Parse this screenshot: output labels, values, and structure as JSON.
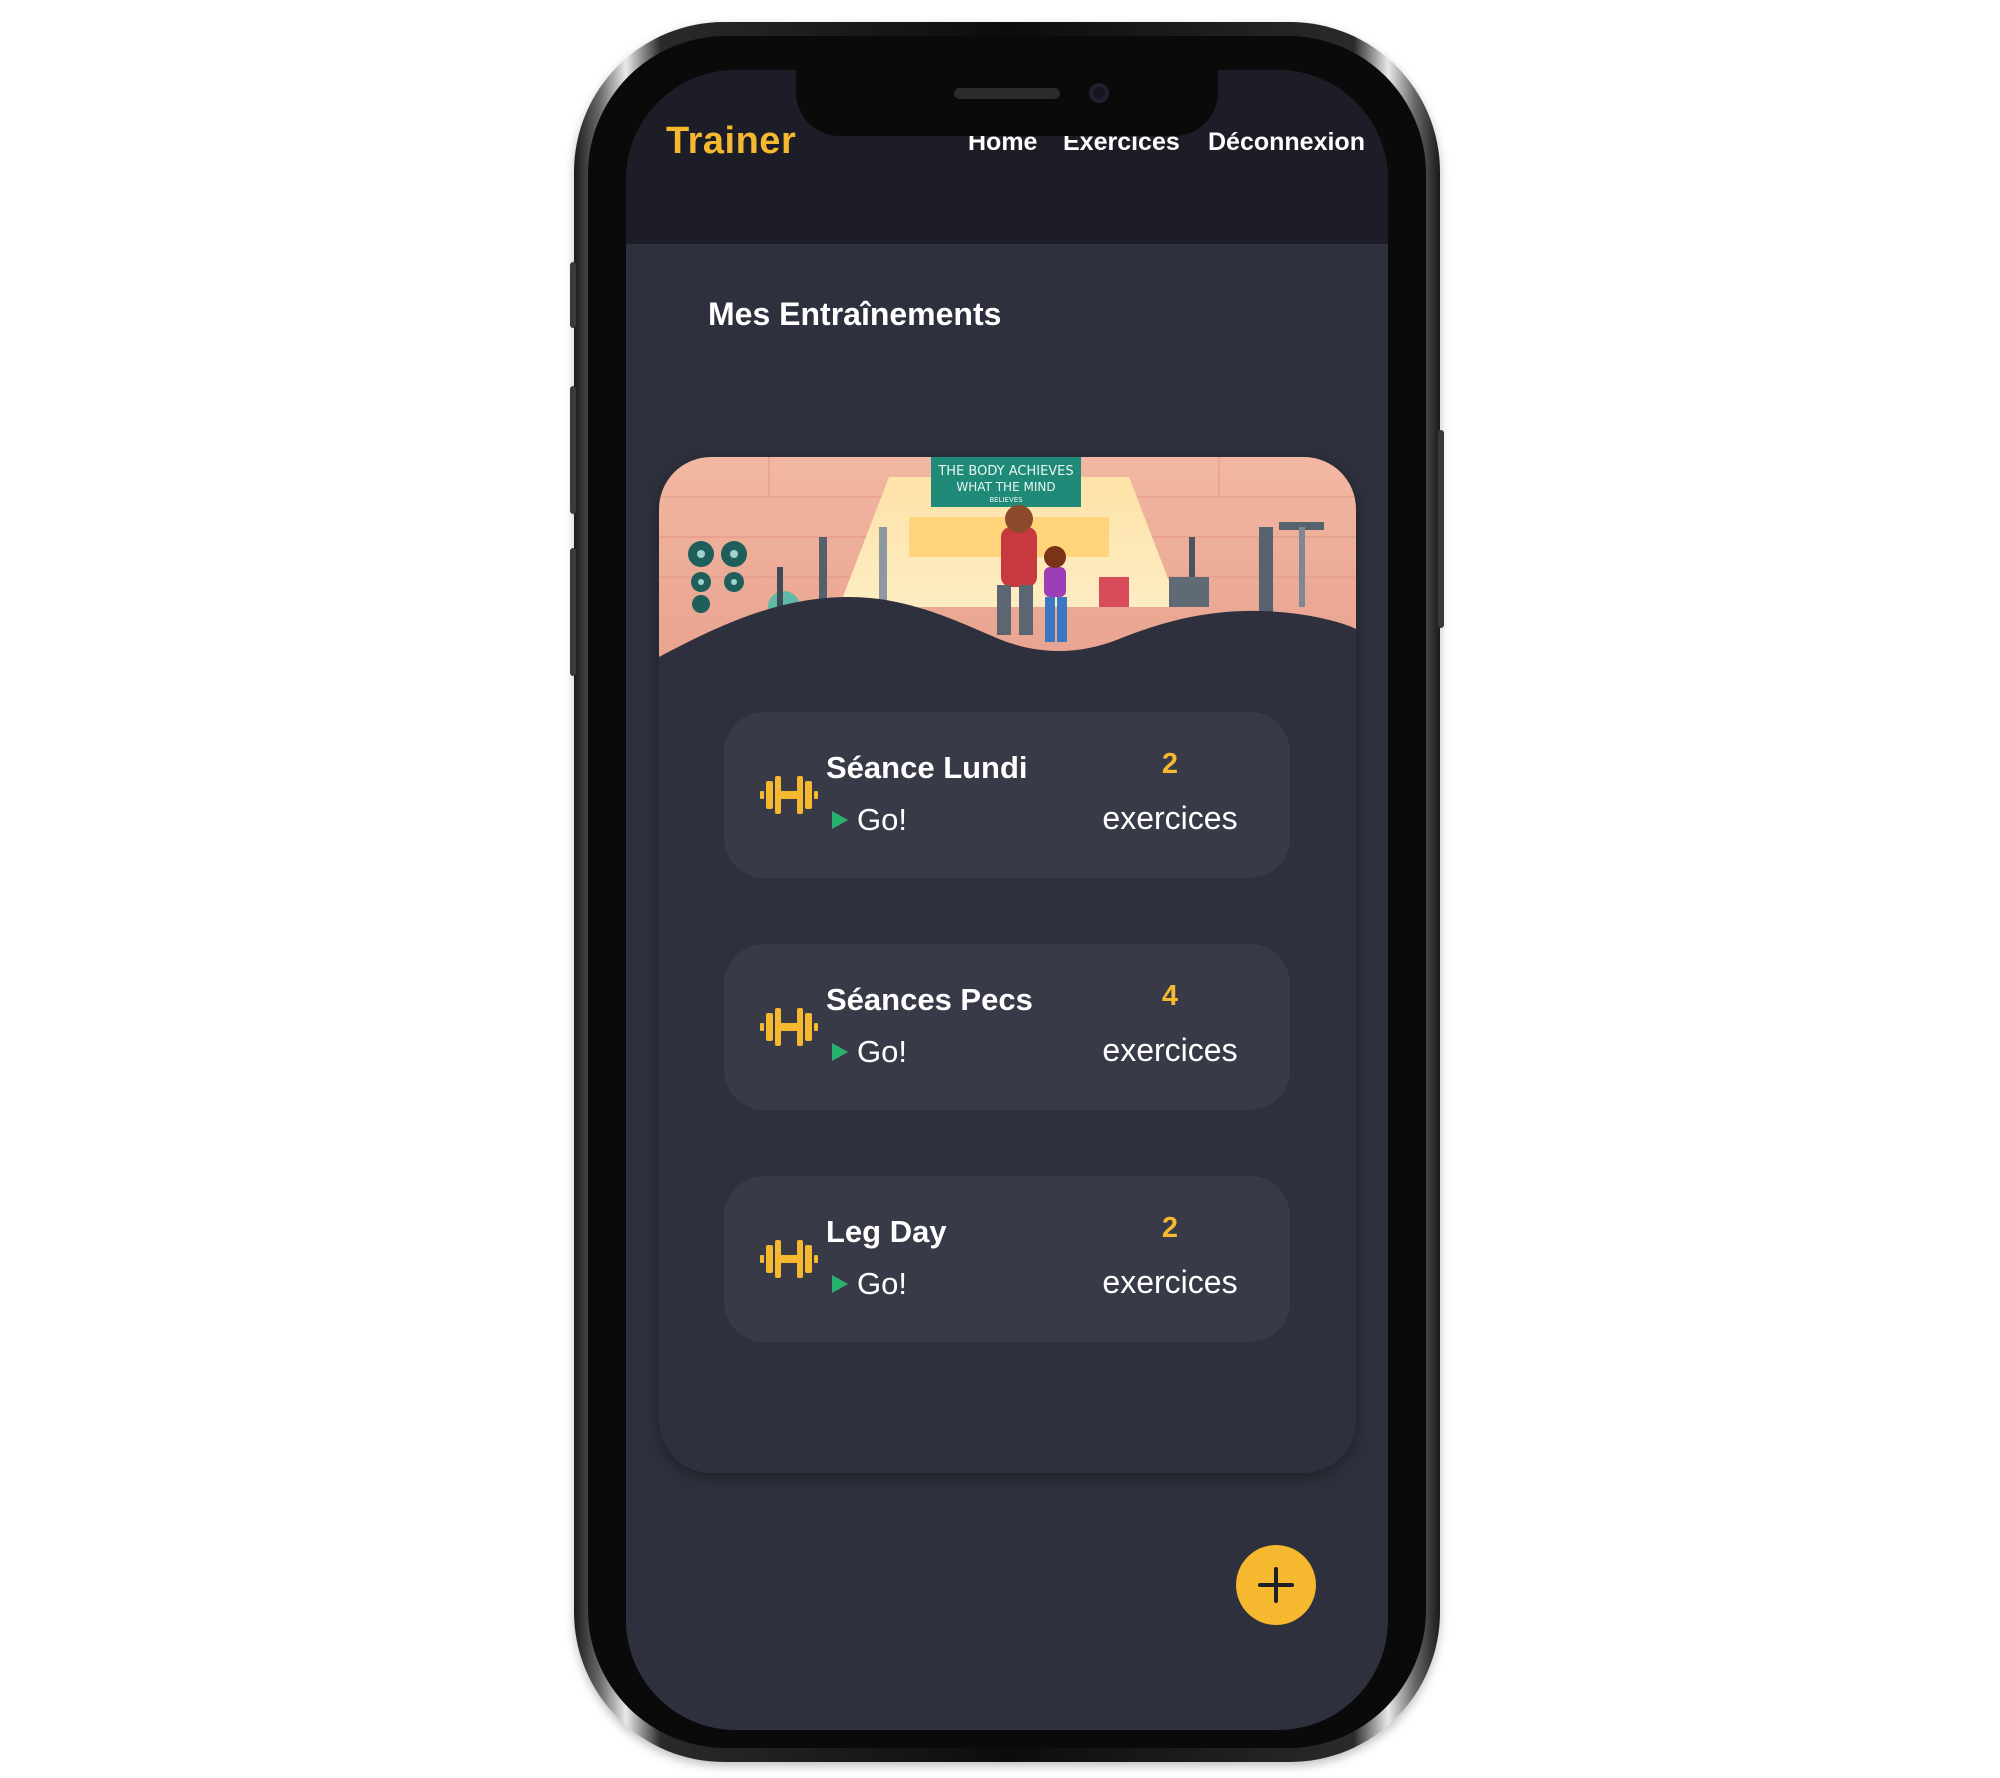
{
  "header": {
    "brand": "Trainer",
    "nav": {
      "home": "Home",
      "exercises": "Exercices",
      "logout": "Déconnexion"
    }
  },
  "page_title": "Mes Entraînements",
  "banner": {
    "sign_line1": "THE BODY ACHIEVES",
    "sign_line2": "WHAT THE MIND",
    "sign_line3": "BELIEVES"
  },
  "workouts": [
    {
      "name": "Séance Lundi",
      "action": "Go!",
      "count": "2",
      "count_label": "exercices"
    },
    {
      "name": "Séances Pecs",
      "action": "Go!",
      "count": "4",
      "count_label": "exercices"
    },
    {
      "name": "Leg Day",
      "action": "Go!",
      "count": "2",
      "count_label": "exercices"
    }
  ],
  "fab": {
    "icon": "plus-icon"
  },
  "colors": {
    "accent": "#f5b82e",
    "go": "#27b36b",
    "background": "#2e303d",
    "header": "#1c1d26",
    "card_item": "#383a47"
  }
}
